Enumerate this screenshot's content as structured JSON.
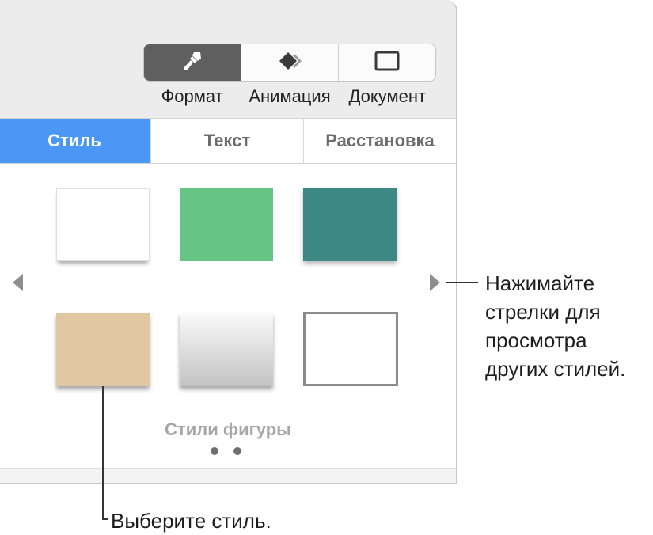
{
  "toolbar": {
    "segments": [
      {
        "label": "Формат",
        "icon": "paintbrush-icon",
        "active": true
      },
      {
        "label": "Анимация",
        "icon": "animation-diamond-icon",
        "active": false
      },
      {
        "label": "Документ",
        "icon": "document-rectangle-icon",
        "active": false
      }
    ],
    "active_color": "#5f5f5f"
  },
  "tabs": [
    {
      "label": "Стиль",
      "active": true
    },
    {
      "label": "Текст",
      "active": false
    },
    {
      "label": "Расстановка",
      "active": false
    }
  ],
  "tab_active_color": "#4a97f5",
  "shape_styles": {
    "label": "Стили фигуры",
    "swatches": [
      {
        "name": "white-paper",
        "color": "#ffffff"
      },
      {
        "name": "green",
        "color": "#66c585"
      },
      {
        "name": "teal-textured",
        "color": "#3d8785"
      },
      {
        "name": "tan",
        "color": "#dfc7a1"
      },
      {
        "name": "gray-gradient",
        "color": "#c3c3c3"
      },
      {
        "name": "outline",
        "color": "#8b8b8b"
      }
    ],
    "page_count": 2
  },
  "callouts": {
    "arrows_text": "Нажимайте\nстрелки для\nпросмотра\nдругих стилей.",
    "select_text": "Выберите стиль."
  }
}
